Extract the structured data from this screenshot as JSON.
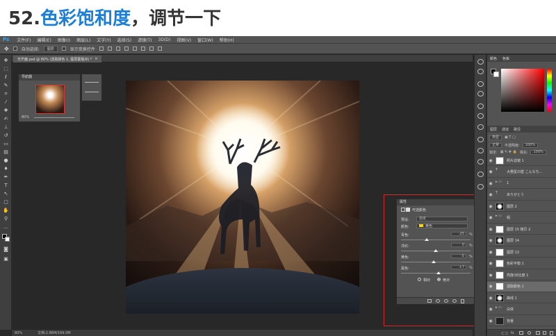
{
  "heading": {
    "number": "52.",
    "accent": "色彩饱和度",
    "rest": "，调节一下"
  },
  "menu": {
    "logo": "Ps",
    "items": [
      "文件(F)",
      "编辑(E)",
      "图像(I)",
      "图层(L)",
      "文字(Y)",
      "选择(S)",
      "滤镜(T)",
      "3D(D)",
      "视图(V)",
      "窗口(W)",
      "帮助(H)"
    ]
  },
  "options": {
    "auto_select": "自动选择:",
    "target": "图层",
    "transform": "显示变换控件"
  },
  "document_tab": {
    "label": "光芒鹿.psd @ 80% (选取颜色 1, 图层蒙版/8) *",
    "close": "×"
  },
  "navigator": {
    "title": "导航器",
    "zoom": "80%"
  },
  "properties": {
    "title": "属性",
    "subtitle": "可选颜色",
    "preset_label": "预设:",
    "preset_value": "自定",
    "colors_label": "颜色:",
    "colors_value": "黄色",
    "sliders": [
      {
        "label": "青色:",
        "value": "-25",
        "unit": "%",
        "pos": 0.37
      },
      {
        "label": "洋红:",
        "value": "0",
        "unit": "%",
        "pos": 0.5
      },
      {
        "label": "黄色:",
        "value": "-5",
        "unit": "%",
        "pos": 0.47
      },
      {
        "label": "黑色:",
        "value": "+7",
        "unit": "%",
        "pos": 0.54
      }
    ],
    "mode_relative": "相对",
    "mode_absolute": "绝对"
  },
  "status": {
    "zoom": "80%",
    "doc": "文档:2.86M/169.0M"
  },
  "right_panel": {
    "color_tabs": [
      "颜色",
      "色板"
    ],
    "layer_tabs": [
      "图层",
      "通道",
      "路径"
    ],
    "kind": "类型",
    "blend": "正常",
    "opacity_label": "不透明度:",
    "opacity": "100%",
    "lock_label": "锁定:",
    "fill_label": "填充:",
    "fill": "100%",
    "layers": [
      {
        "name": "照片滤镜 1",
        "thumb": "white",
        "selected": false
      },
      {
        "name": "大橙星の壁 こんなち...",
        "thumb": "text",
        "selected": false
      },
      {
        "name": "1",
        "thumb": "folder",
        "selected": false
      },
      {
        "name": "ありがとう",
        "thumb": "text",
        "selected": false
      },
      {
        "name": "图层 2",
        "thumb": "mask",
        "selected": false
      },
      {
        "name": "组",
        "thumb": "folder",
        "selected": false
      },
      {
        "name": "图层 15 拷贝 2",
        "thumb": "white",
        "selected": false
      },
      {
        "name": "图层 14",
        "thumb": "mask",
        "selected": false
      },
      {
        "name": "图层 13",
        "thumb": "white",
        "selected": false
      },
      {
        "name": "色彩平衡 1",
        "thumb": "white",
        "selected": false
      },
      {
        "name": "亮度/对比度 1",
        "thumb": "white",
        "selected": false
      },
      {
        "name": "选取颜色 1",
        "thumb": "white",
        "selected": true
      },
      {
        "name": "曲线 1",
        "thumb": "mask",
        "selected": false
      },
      {
        "name": "白体",
        "thumb": "folder",
        "selected": false
      },
      {
        "name": "背景",
        "thumb": "dark",
        "selected": false
      }
    ]
  },
  "colors": {
    "accent": "#1c7ed6",
    "highlight_box": "#d62828",
    "ps_blue": "#31a8ff"
  }
}
